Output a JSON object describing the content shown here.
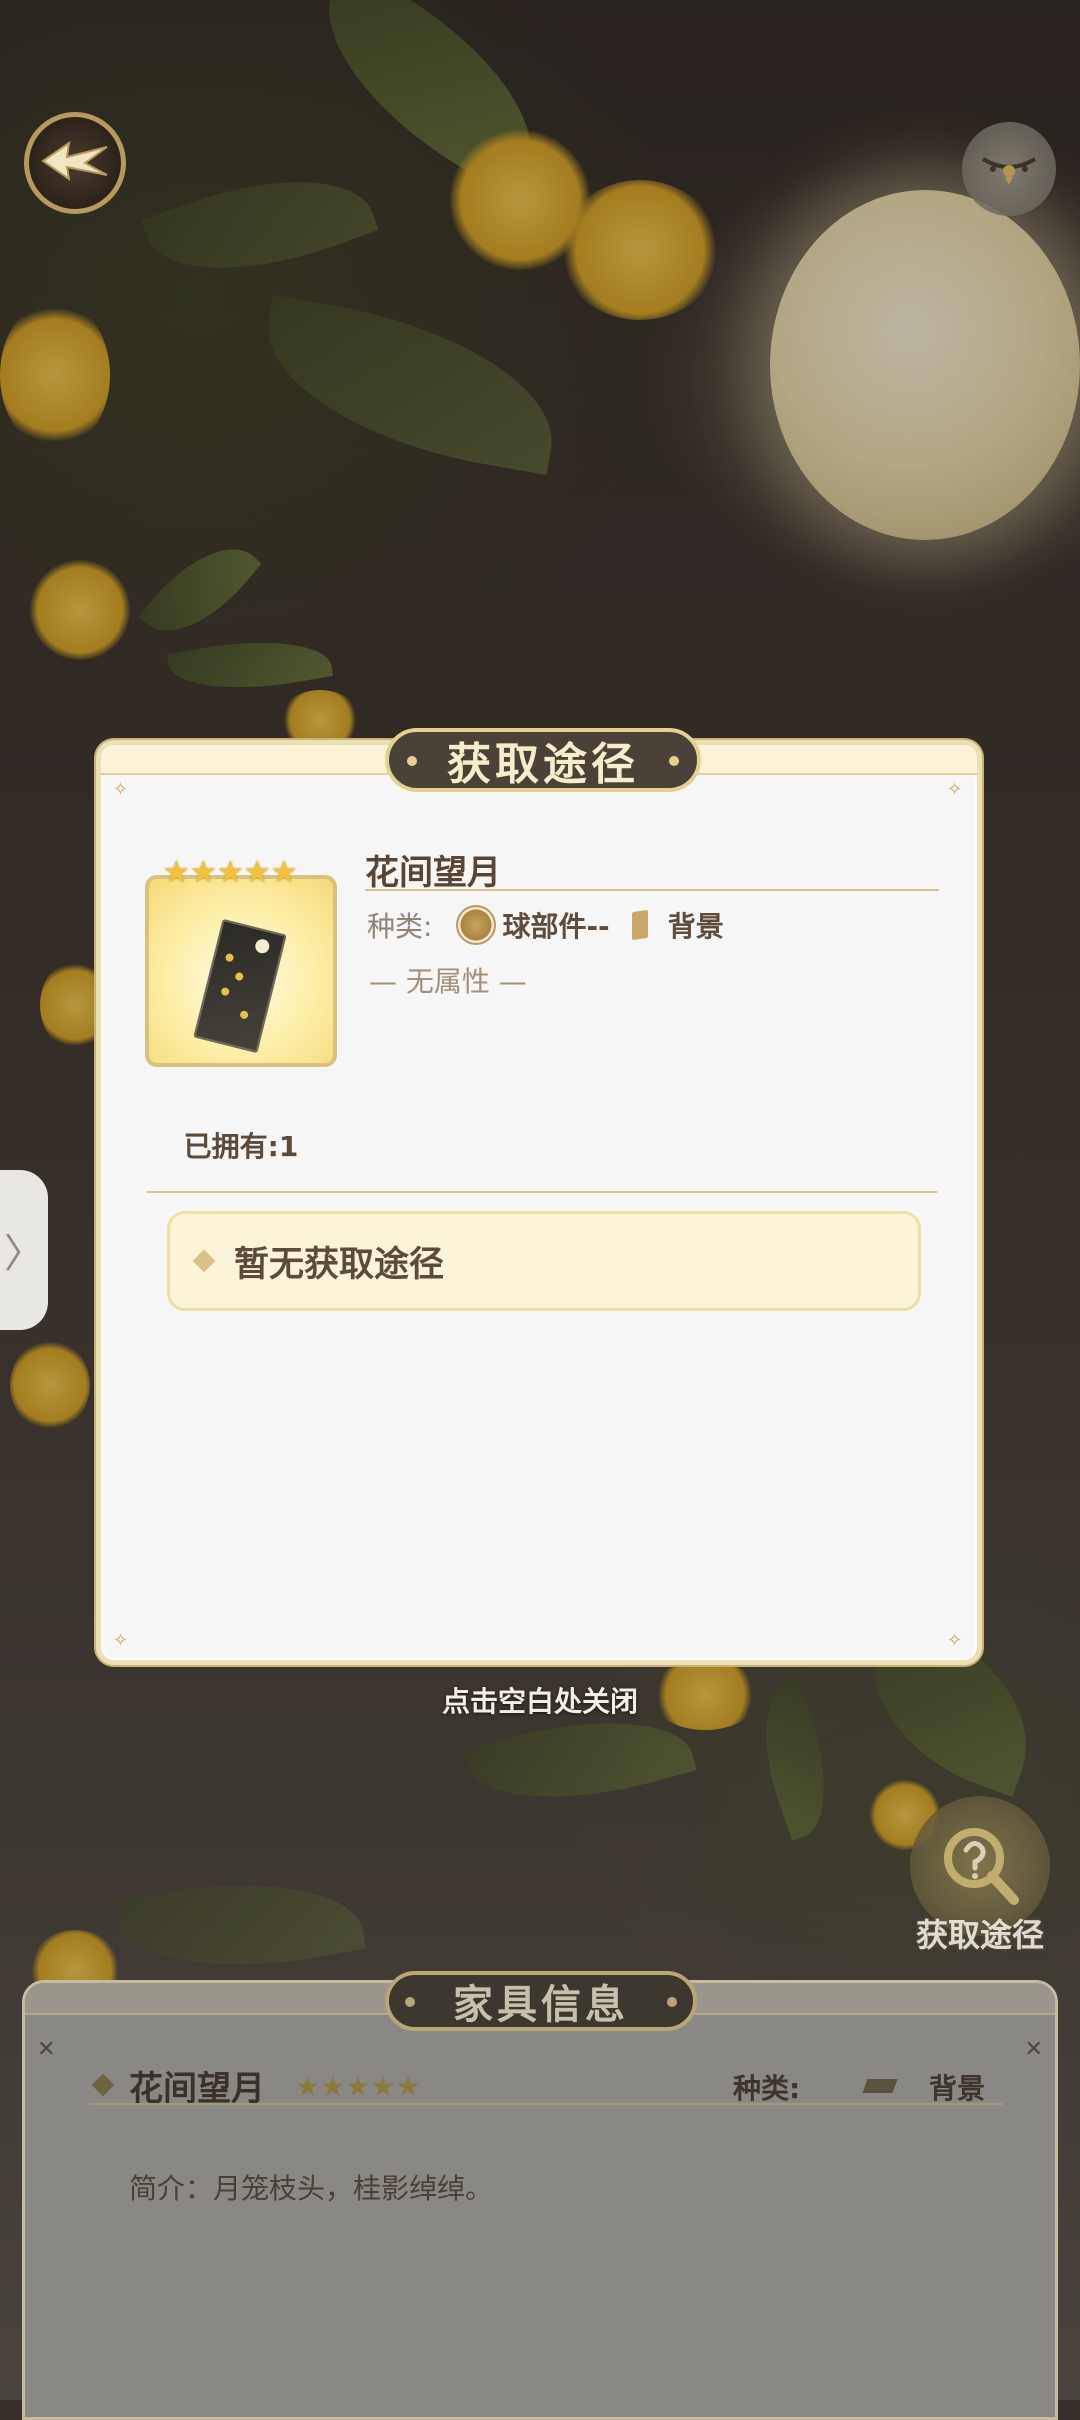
{
  "modal": {
    "title": "获取途径",
    "item_name": "花间望月",
    "kind_label": "种类:",
    "kind_part": "球部件--",
    "kind_value": "背景",
    "attribute": "— 无属性 —",
    "owned": "已拥有:1",
    "stars": 5,
    "source_text": "暂无获取途径"
  },
  "close_hint": "点击空白处关闭",
  "obtain_button": {
    "label": "获取途径"
  },
  "info_panel": {
    "title": "家具信息",
    "item_name": "花间望月",
    "stars": 5,
    "kind_label": "种类:",
    "kind_value": "背景",
    "description": "简介：月笼枝头，桂影绰绰。"
  },
  "icons": {
    "back": "leaf-back-icon",
    "menu": "ornament-menu-icon",
    "side_tab": "chevron-right-icon",
    "obtain": "magnifier-question-icon",
    "category_ball": "ball-part-icon",
    "category_background": "background-icon"
  },
  "colors": {
    "panel_bg": "#f6f6f7",
    "gold_border": "#ebdfb4",
    "pill_dark": "#4a4238",
    "text_brown": "#5a4534"
  }
}
